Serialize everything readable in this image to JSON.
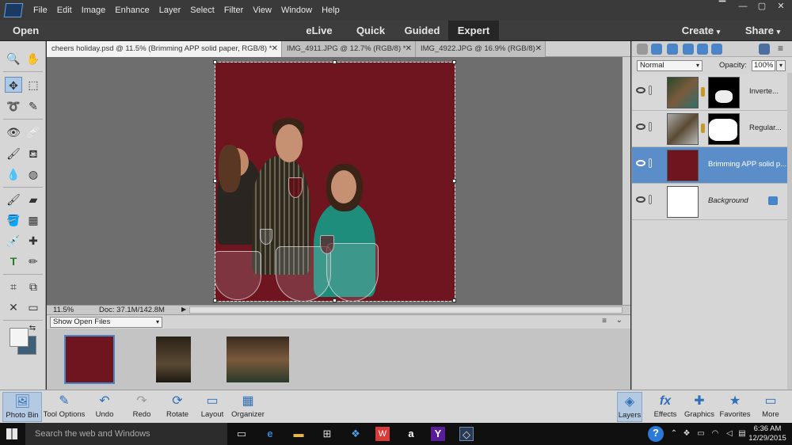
{
  "menubar": {
    "items": [
      "File",
      "Edit",
      "Image",
      "Enhance",
      "Layer",
      "Select",
      "Filter",
      "View",
      "Window",
      "Help"
    ],
    "window_controls": [
      "▔",
      "—",
      "▢",
      "✕"
    ]
  },
  "modebar": {
    "open_label": "Open",
    "modes": [
      "eLive",
      "Quick",
      "Guided",
      "Expert"
    ],
    "active_mode": "Expert",
    "create_label": "Create",
    "share_label": "Share"
  },
  "tabs": [
    {
      "label": "cheers holiday.psd @ 11.5% (Brimming APP solid paper, RGB/8) *",
      "active": true
    },
    {
      "label": "IMG_4911.JPG @ 12.7% (RGB/8) *",
      "active": false
    },
    {
      "label": "IMG_4922.JPG @ 16.9% (RGB/8)",
      "active": false
    }
  ],
  "status": {
    "zoom": "11.5%",
    "doc": "Doc: 37.1M/142.8M"
  },
  "photo_bin": {
    "dropdown": "Show Open Files"
  },
  "layers_panel": {
    "blend_mode": "Normal",
    "opacity_label": "Opacity:",
    "opacity_value": "100%",
    "layers": [
      {
        "name": "Inverte..."
      },
      {
        "name": "Regular..."
      },
      {
        "name": "Brimming APP solid p..."
      },
      {
        "name": "Background"
      }
    ]
  },
  "bottombar": {
    "left": [
      "Photo Bin",
      "Tool Options",
      "Undo",
      "Redo",
      "Rotate",
      "Layout",
      "Organizer"
    ],
    "right": [
      "Layers",
      "Effects",
      "Graphics",
      "Favorites",
      "More"
    ]
  },
  "taskbar": {
    "search_placeholder": "Search the web and Windows",
    "time": "6:36 AM",
    "date": "12/29/2015"
  },
  "colors": {
    "accent": "#2f6fb8",
    "canvas_fill": "#6e1520",
    "selected_layer": "#5b8dc9"
  }
}
